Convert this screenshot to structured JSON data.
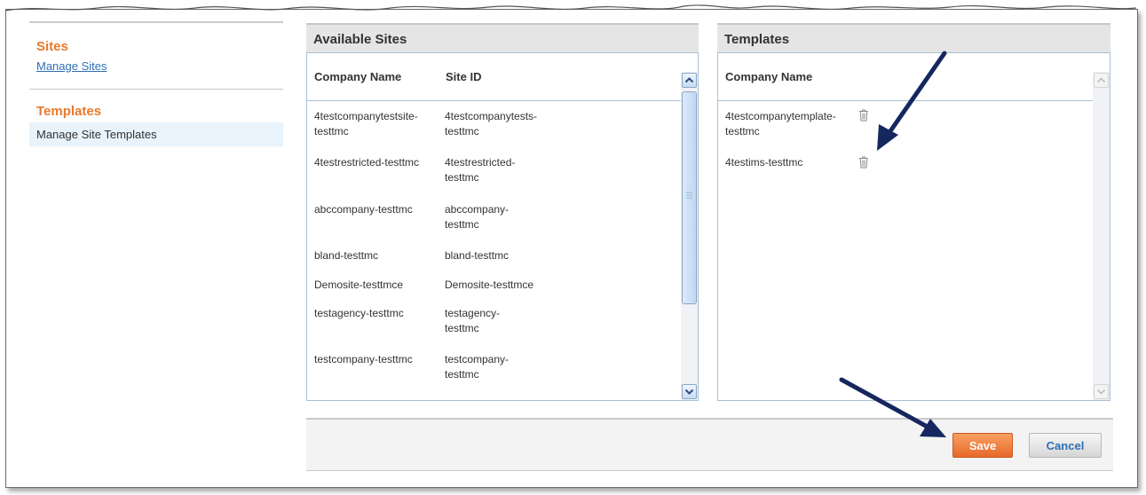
{
  "nav": {
    "sites_heading": "Sites",
    "manage_sites_link": "Manage Sites",
    "templates_heading": "Templates",
    "manage_templates_item": "Manage Site Templates"
  },
  "available_sites": {
    "title": "Available Sites",
    "col_company": "Company Name",
    "col_site_id": "Site ID",
    "rows": [
      {
        "company": "4testcompanytestsite-testtmc",
        "site_id": "4testcompanytests-testtmc"
      },
      {
        "company": "4testrestricted-testtmc",
        "site_id": "4testrestricted-testtmc"
      },
      {
        "company": "abccompany-testtmc",
        "site_id": "abccompany-testtmc"
      },
      {
        "company": "bland-testtmc",
        "site_id": "bland-testtmc"
      },
      {
        "company": "Demosite-testtmce",
        "site_id": "Demosite-testtmce"
      },
      {
        "company": "testagency-testtmc",
        "site_id": "testagency-testtmc"
      },
      {
        "company": "testcompany-testtmc",
        "site_id": "testcompany-testtmc"
      }
    ]
  },
  "templates": {
    "title": "Templates",
    "col_company": "Company Name",
    "rows": [
      {
        "company": "4testcompanytemplate-testtmc"
      },
      {
        "company": "4testims-testtmc"
      }
    ]
  },
  "footer": {
    "save_label": "Save",
    "cancel_label": "Cancel"
  },
  "colors": {
    "accent_orange": "#e8792c",
    "link_blue": "#2f6fb5",
    "annotation_arrow": "#15275e"
  },
  "icons": [
    "trash-icon",
    "scroll-up-icon",
    "scroll-down-icon",
    "annotation-arrow"
  ]
}
